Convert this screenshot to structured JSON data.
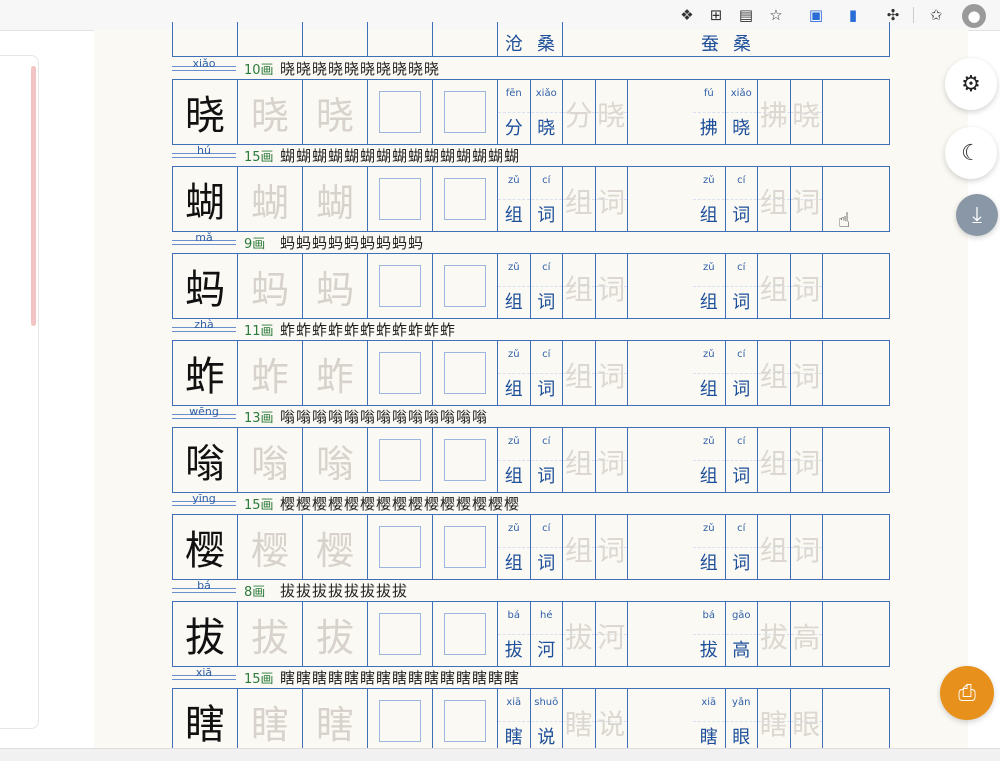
{
  "toolbar": {
    "icons": [
      "copilot-icon",
      "extensions-grid-icon",
      "reading-view-icon",
      "favorite-star-icon",
      "shield-download-icon",
      "page-icon",
      "puzzle-icon",
      "favorites-list-icon",
      "profile-avatar-icon"
    ]
  },
  "top_partial": {
    "word1": {
      "chars": [
        "沧",
        "桑"
      ]
    },
    "word2": {
      "chars": [
        "蚕",
        "桑"
      ]
    }
  },
  "rows": [
    {
      "pinyin": "xiǎo",
      "strokes": "10画",
      "sequence": "晓晓晓晓晓晓晓晓晓晓",
      "char": "晓",
      "words": [
        {
          "py": [
            "fēn",
            "xiǎo"
          ],
          "ch": [
            "分",
            "晓"
          ]
        },
        {
          "py": [
            "fú",
            "xiǎo"
          ],
          "ch": [
            "拂",
            "晓"
          ]
        }
      ]
    },
    {
      "pinyin": "hú",
      "strokes": "15画",
      "sequence": "蝴蝴蝴蝴蝴蝴蝴蝴蝴蝴蝴蝴蝴蝴蝴",
      "char": "蝴",
      "words": [
        {
          "py": [
            "zǔ",
            "cí"
          ],
          "ch": [
            "组",
            "词"
          ]
        },
        {
          "py": [
            "zǔ",
            "cí"
          ],
          "ch": [
            "组",
            "词"
          ]
        }
      ]
    },
    {
      "pinyin": "mǎ",
      "strokes": "9画",
      "sequence": "蚂蚂蚂蚂蚂蚂蚂蚂蚂",
      "char": "蚂",
      "words": [
        {
          "py": [
            "zǔ",
            "cí"
          ],
          "ch": [
            "组",
            "词"
          ]
        },
        {
          "py": [
            "zǔ",
            "cí"
          ],
          "ch": [
            "组",
            "词"
          ]
        }
      ]
    },
    {
      "pinyin": "zhà",
      "strokes": "11画",
      "sequence": "蚱蚱蚱蚱蚱蚱蚱蚱蚱蚱蚱",
      "char": "蚱",
      "words": [
        {
          "py": [
            "zǔ",
            "cí"
          ],
          "ch": [
            "组",
            "词"
          ]
        },
        {
          "py": [
            "zǔ",
            "cí"
          ],
          "ch": [
            "组",
            "词"
          ]
        }
      ]
    },
    {
      "pinyin": "wēng",
      "strokes": "13画",
      "sequence": "嗡嗡嗡嗡嗡嗡嗡嗡嗡嗡嗡嗡嗡",
      "char": "嗡",
      "words": [
        {
          "py": [
            "zǔ",
            "cí"
          ],
          "ch": [
            "组",
            "词"
          ]
        },
        {
          "py": [
            "zǔ",
            "cí"
          ],
          "ch": [
            "组",
            "词"
          ]
        }
      ]
    },
    {
      "pinyin": "yīng",
      "strokes": "15画",
      "sequence": "樱樱樱樱樱樱樱樱樱樱樱樱樱樱樱",
      "char": "樱",
      "words": [
        {
          "py": [
            "zǔ",
            "cí"
          ],
          "ch": [
            "组",
            "词"
          ]
        },
        {
          "py": [
            "zǔ",
            "cí"
          ],
          "ch": [
            "组",
            "词"
          ]
        }
      ]
    },
    {
      "pinyin": "bá",
      "strokes": "8画",
      "sequence": "拔拔拔拔拔拔拔拔",
      "char": "拔",
      "words": [
        {
          "py": [
            "bá",
            "hé"
          ],
          "ch": [
            "拔",
            "河"
          ]
        },
        {
          "py": [
            "bá",
            "gāo"
          ],
          "ch": [
            "拔",
            "高"
          ]
        }
      ]
    },
    {
      "pinyin": "xiā",
      "strokes": "15画",
      "sequence": "瞎瞎瞎瞎瞎瞎瞎瞎瞎瞎瞎瞎瞎瞎瞎",
      "char": "瞎",
      "words": [
        {
          "py": [
            "xiā",
            "shuō"
          ],
          "ch": [
            "瞎",
            "说"
          ]
        },
        {
          "py": [
            "xiā",
            "yǎn"
          ],
          "ch": [
            "瞎",
            "眼"
          ]
        }
      ]
    }
  ],
  "fabs": {
    "settings": "settings-gear-icon",
    "theme": "dark-mode-moon-icon",
    "download": "download-icon",
    "print": "print-icon"
  },
  "colors": {
    "grid": "#3f6fb8",
    "print": "#e8901c",
    "page": "#fbf9f3"
  }
}
